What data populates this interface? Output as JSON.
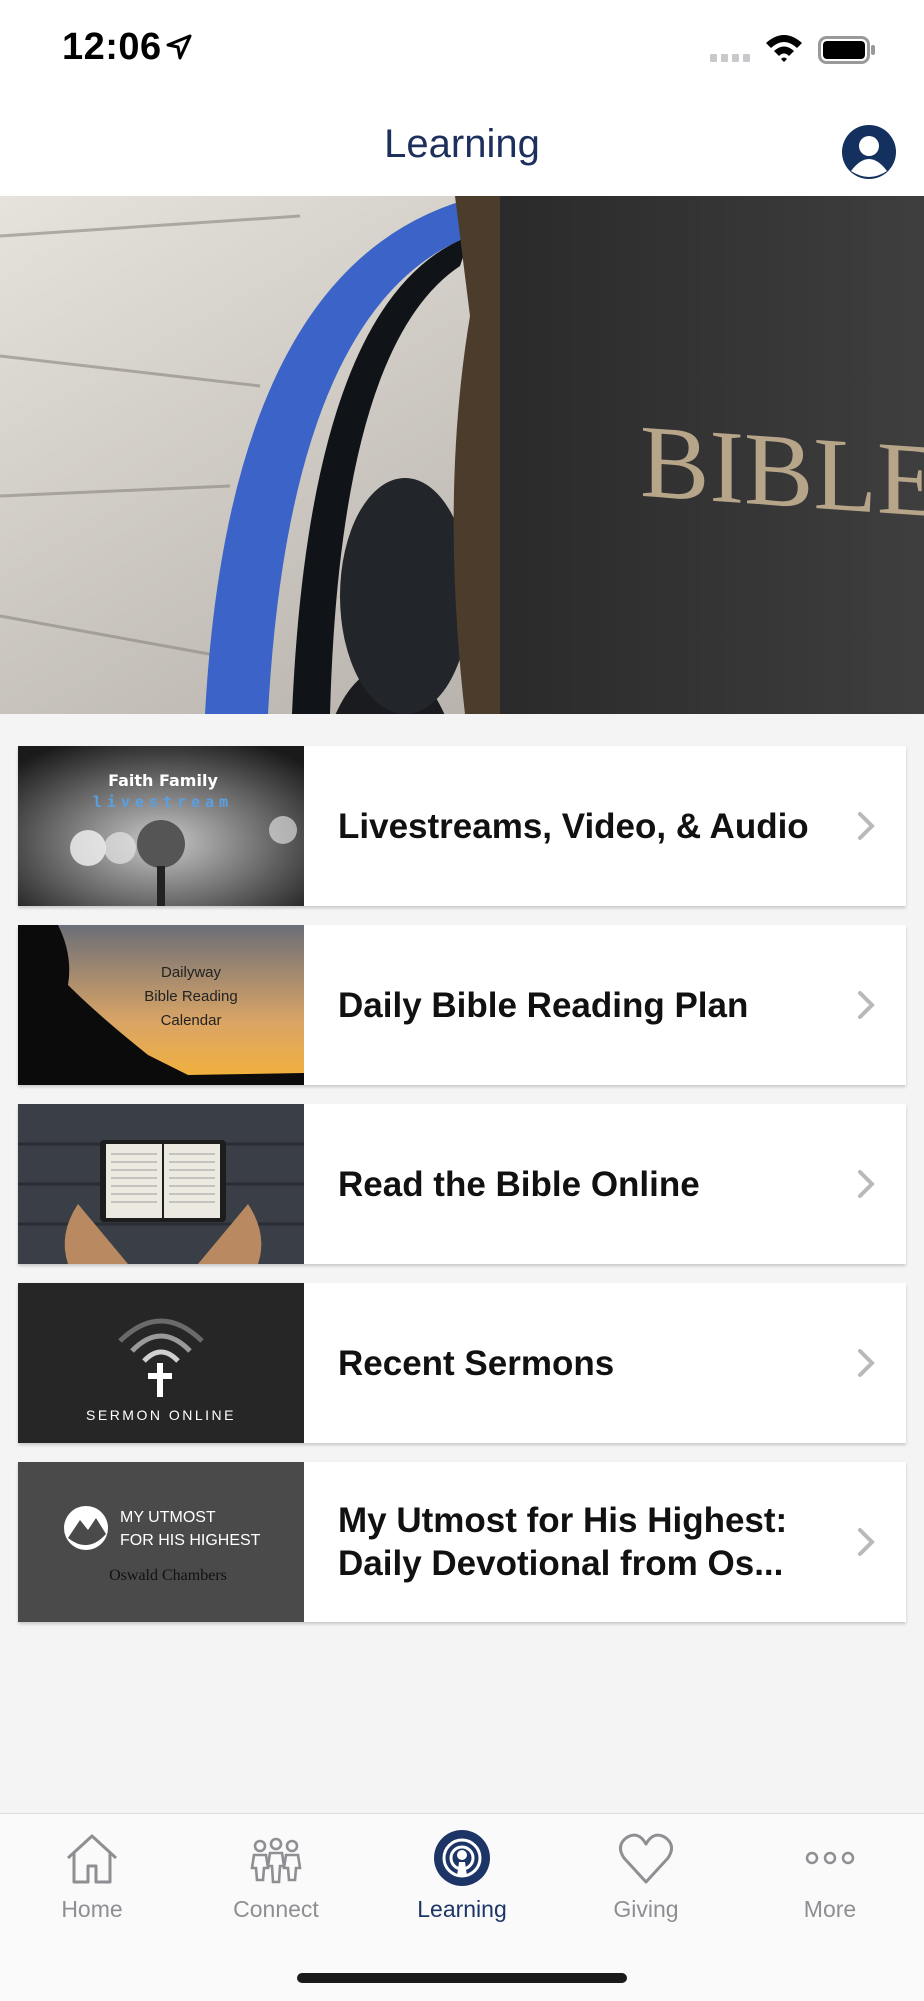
{
  "status_bar": {
    "time": "12:06"
  },
  "header": {
    "title": "Learning"
  },
  "hero": {
    "image_icon": "bible-headphones-photo",
    "book_text": "BIBLE"
  },
  "items": [
    {
      "label": "Livestreams, Video, & Audio",
      "thumb_lines": [
        "Faith Family",
        "livestream"
      ]
    },
    {
      "label": "Daily Bible Reading Plan",
      "thumb_lines": [
        "Dailyway",
        "Bible Reading",
        "Calendar"
      ]
    },
    {
      "label": "Read the Bible Online",
      "thumb_lines": []
    },
    {
      "label": "Recent Sermons",
      "thumb_lines": [
        "Sermon Online"
      ]
    },
    {
      "label": "My Utmost for His Highest: Daily Devotional from Os...",
      "thumb_lines": [
        "MY UTMOST",
        "FOR HIS HIGHEST",
        "Oswald Chambers"
      ]
    }
  ],
  "tabs": [
    {
      "label": "Home",
      "icon": "home-icon"
    },
    {
      "label": "Connect",
      "icon": "people-icon"
    },
    {
      "label": "Learning",
      "icon": "podcast-icon",
      "active": true
    },
    {
      "label": "Giving",
      "icon": "heart-icon"
    },
    {
      "label": "More",
      "icon": "more-dots-icon"
    }
  ],
  "colors": {
    "accent": "#1d3566",
    "inactive": "#8e8e93",
    "background": "#f4f4f5"
  }
}
